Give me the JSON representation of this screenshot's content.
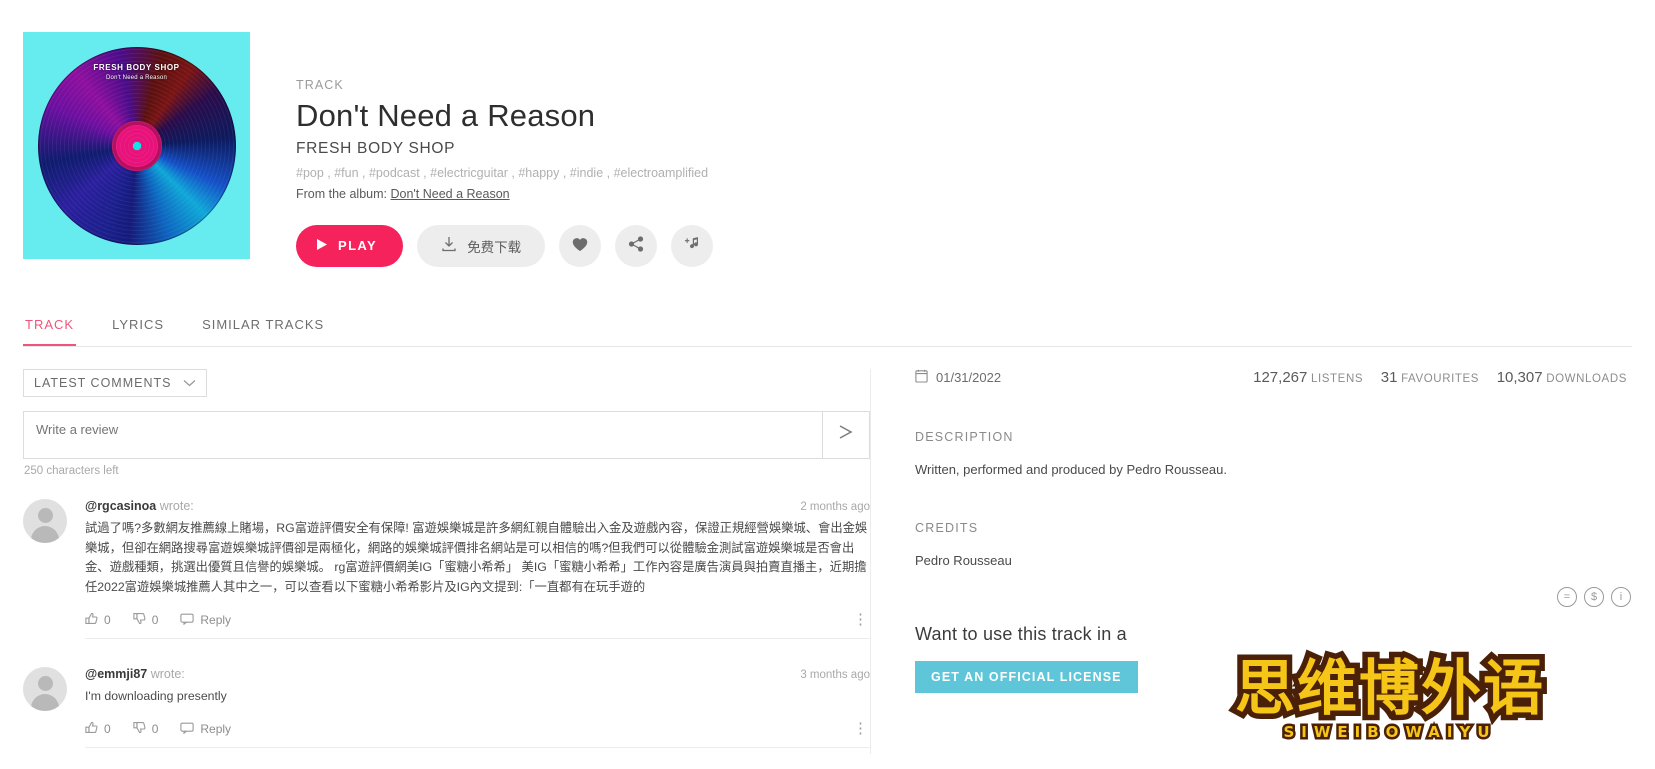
{
  "hero": {
    "kicker": "TRACK",
    "title": "Don't Need a Reason",
    "artist": "FRESH BODY SHOP",
    "tags": "#pop , #fun , #podcast , #electricguitar , #happy , #indie , #electroamplified",
    "album_prefix": "From the album: ",
    "album_name": "Don't Need a Reason",
    "cover_label_artist": "FRESH BODY SHOP",
    "cover_label_title": "Don't Need a Reason"
  },
  "actions": {
    "play": "PLAY",
    "download": "免费下载",
    "favourite_icon": "heart-icon",
    "share_icon": "share-icon",
    "playlist_icon": "add-to-playlist-icon"
  },
  "tabs": [
    {
      "label": "TRACK",
      "active": true
    },
    {
      "label": "LYRICS",
      "active": false
    },
    {
      "label": "SIMILAR TRACKS",
      "active": false
    }
  ],
  "comments_panel": {
    "sort_label": "LATEST COMMENTS",
    "review_placeholder": "Write a review",
    "send_label": "➤",
    "chars_left": "250 characters left",
    "items": [
      {
        "user": "@rgcasinoa",
        "wrote": "wrote:",
        "time": "2 months ago",
        "text": "試過了嗎?多數網友推薦線上賭場，RG富遊評價安全有保障! 富遊娛樂城是許多網紅親自體驗出入金及遊戲內容，保證正規經營娛樂城、會出金娛樂城，但卻在網路搜尋富遊娛樂城評價卻是兩極化，網路的娛樂城評價排名網站是可以相信的嗎?但我們可以從體驗金測試富遊娛樂城是否會出金、遊戲種類，挑選出優質且信譽的娛樂城。 rg富遊評價網美IG「蜜糖小希希」 美IG「蜜糖小希希」工作內容是廣告演員與拍賣直播主，近期擔任2022富遊娛樂城推薦人其中之一，可以查看以下蜜糖小希希影片及IG內文提到:「一直都有在玩手遊的",
        "likes": "0",
        "dislikes": "0",
        "reply": "Reply"
      },
      {
        "user": "@emmji87",
        "wrote": "wrote:",
        "time": "3 months ago",
        "text": "I'm downloading presently",
        "likes": "0",
        "dislikes": "0",
        "reply": "Reply"
      }
    ]
  },
  "info_panel": {
    "date": "01/31/2022",
    "date_icon": "calendar-icon",
    "listens_value": "127,267",
    "listens_label": "LISTENS",
    "favourites_value": "31",
    "favourites_label": "FAVOURITES",
    "downloads_value": "10,307",
    "downloads_label": "DOWNLOADS",
    "description_title": "DESCRIPTION",
    "description_body": "Written, performed and produced by Pedro Rousseau.",
    "credits_title": "CREDITS",
    "credits_body": "Pedro Rousseau",
    "license_question": "Want to use this track in a",
    "license_button": "GET AN OFFICIAL LICENSE",
    "cc_icons": [
      "=",
      "$",
      "i"
    ]
  },
  "watermark": {
    "main": "思维博外语",
    "sub": "SIWEIBOWAIYU"
  },
  "colors": {
    "accent": "#f5225c",
    "tab_active": "#f0547d",
    "license_button": "#5ec6d8",
    "cover_bg": "#66ecef"
  }
}
